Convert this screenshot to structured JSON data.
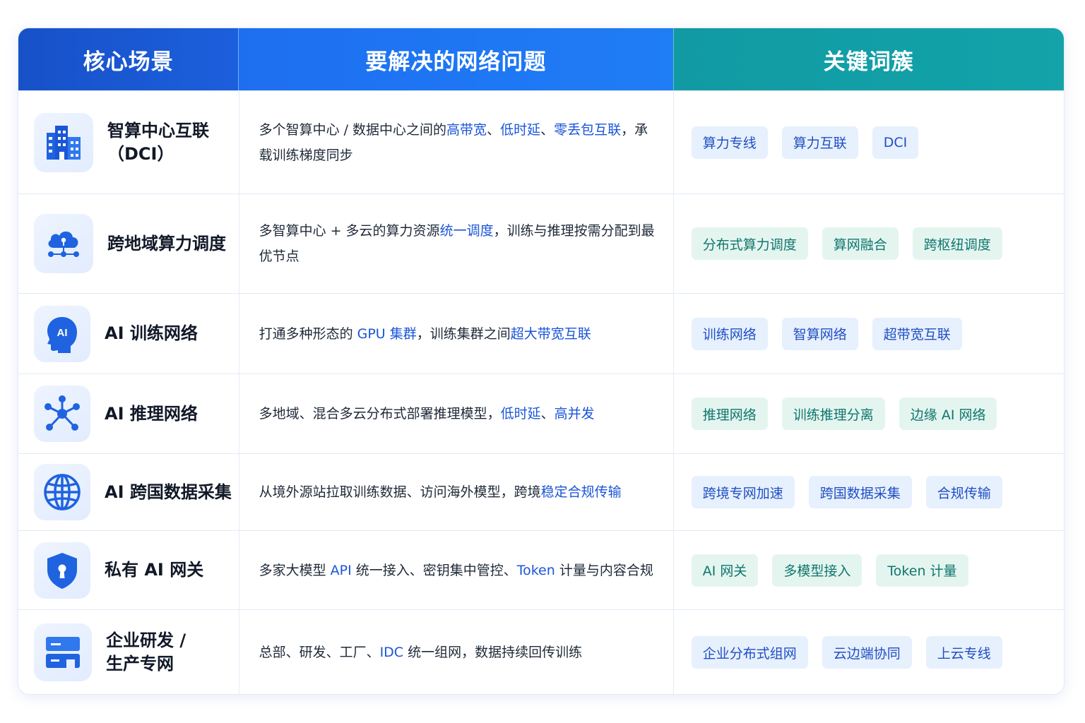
{
  "header": {
    "col1": "核心场景",
    "col2": "要解决的网络问题",
    "col3": "关键词簇"
  },
  "rows": [
    {
      "icon": "building-icon",
      "scene": [
        "智算中心互联",
        "（DCI）"
      ],
      "desc": [
        {
          "t": "多个智算中心 / 数据中心之间的",
          "h": false
        },
        {
          "t": "高带宽",
          "h": true
        },
        {
          "t": "、",
          "h": false
        },
        {
          "t": "低时延",
          "h": true
        },
        {
          "t": "、",
          "h": false
        },
        {
          "t": "零丢包互联",
          "h": true
        },
        {
          "t": "，承载训练梯度同步",
          "h": false
        }
      ],
      "tag_color": "blue",
      "tags": [
        "算力专线",
        "算力互联",
        "DCI"
      ]
    },
    {
      "icon": "cloud-network-icon",
      "scene": [
        "跨地域算力调度"
      ],
      "desc": [
        {
          "t": "多智算中心 + 多云的算力资源",
          "h": false
        },
        {
          "t": "统一调度",
          "h": true
        },
        {
          "t": "，训练与推理按需分配到最优节点",
          "h": false
        }
      ],
      "tag_color": "teal",
      "tags": [
        "分布式算力调度",
        "算网融合",
        "跨枢纽调度"
      ]
    },
    {
      "icon": "ai-head-icon",
      "scene": [
        "AI 训练网络"
      ],
      "desc": [
        {
          "t": "打通多种形态的 ",
          "h": false
        },
        {
          "t": "GPU 集群",
          "h": true
        },
        {
          "t": "，训练集群之间",
          "h": false
        },
        {
          "t": "超大带宽互联",
          "h": true
        }
      ],
      "tag_color": "blue",
      "tags": [
        "训练网络",
        "智算网络",
        "超带宽互联"
      ]
    },
    {
      "icon": "network-nodes-icon",
      "scene": [
        "AI 推理网络"
      ],
      "desc": [
        {
          "t": "多地域、混合多云分布式部署推理模型，",
          "h": false
        },
        {
          "t": "低时延",
          "h": true
        },
        {
          "t": "、",
          "h": false
        },
        {
          "t": "高并发",
          "h": true
        }
      ],
      "tag_color": "teal",
      "tags": [
        "推理网络",
        "训练推理分离",
        "边缘 AI 网络"
      ]
    },
    {
      "icon": "globe-icon",
      "scene": [
        "AI 跨国数据采集"
      ],
      "desc": [
        {
          "t": "从境外源站拉取训练数据、访问海外模型，跨境",
          "h": false
        },
        {
          "t": "稳定合规传输",
          "h": true
        }
      ],
      "tag_color": "blue",
      "tags": [
        "跨境专网加速",
        "跨国数据采集",
        "合规传输"
      ]
    },
    {
      "icon": "shield-lock-icon",
      "scene": [
        "私有 AI 网关"
      ],
      "desc": [
        {
          "t": "多家大模型 ",
          "h": false
        },
        {
          "t": "API",
          "h": true
        },
        {
          "t": " 统一接入、密钥集中管控、",
          "h": false
        },
        {
          "t": "Token",
          "h": true
        },
        {
          "t": " 计量与内容合规",
          "h": false
        }
      ],
      "tag_color": "teal",
      "tags": [
        "AI 网关",
        "多模型接入",
        "Token 计量"
      ]
    },
    {
      "icon": "enterprise-network-icon",
      "scene": [
        "企业研发 /",
        "生产专网"
      ],
      "desc": [
        {
          "t": "总部、研发、工厂、",
          "h": false
        },
        {
          "t": "IDC",
          "h": true
        },
        {
          "t": " 统一组网，数据持续回传训练",
          "h": false
        }
      ],
      "tag_color": "blue",
      "tags": [
        "企业分布式组网",
        "云边端协同",
        "上云专线"
      ]
    }
  ]
}
